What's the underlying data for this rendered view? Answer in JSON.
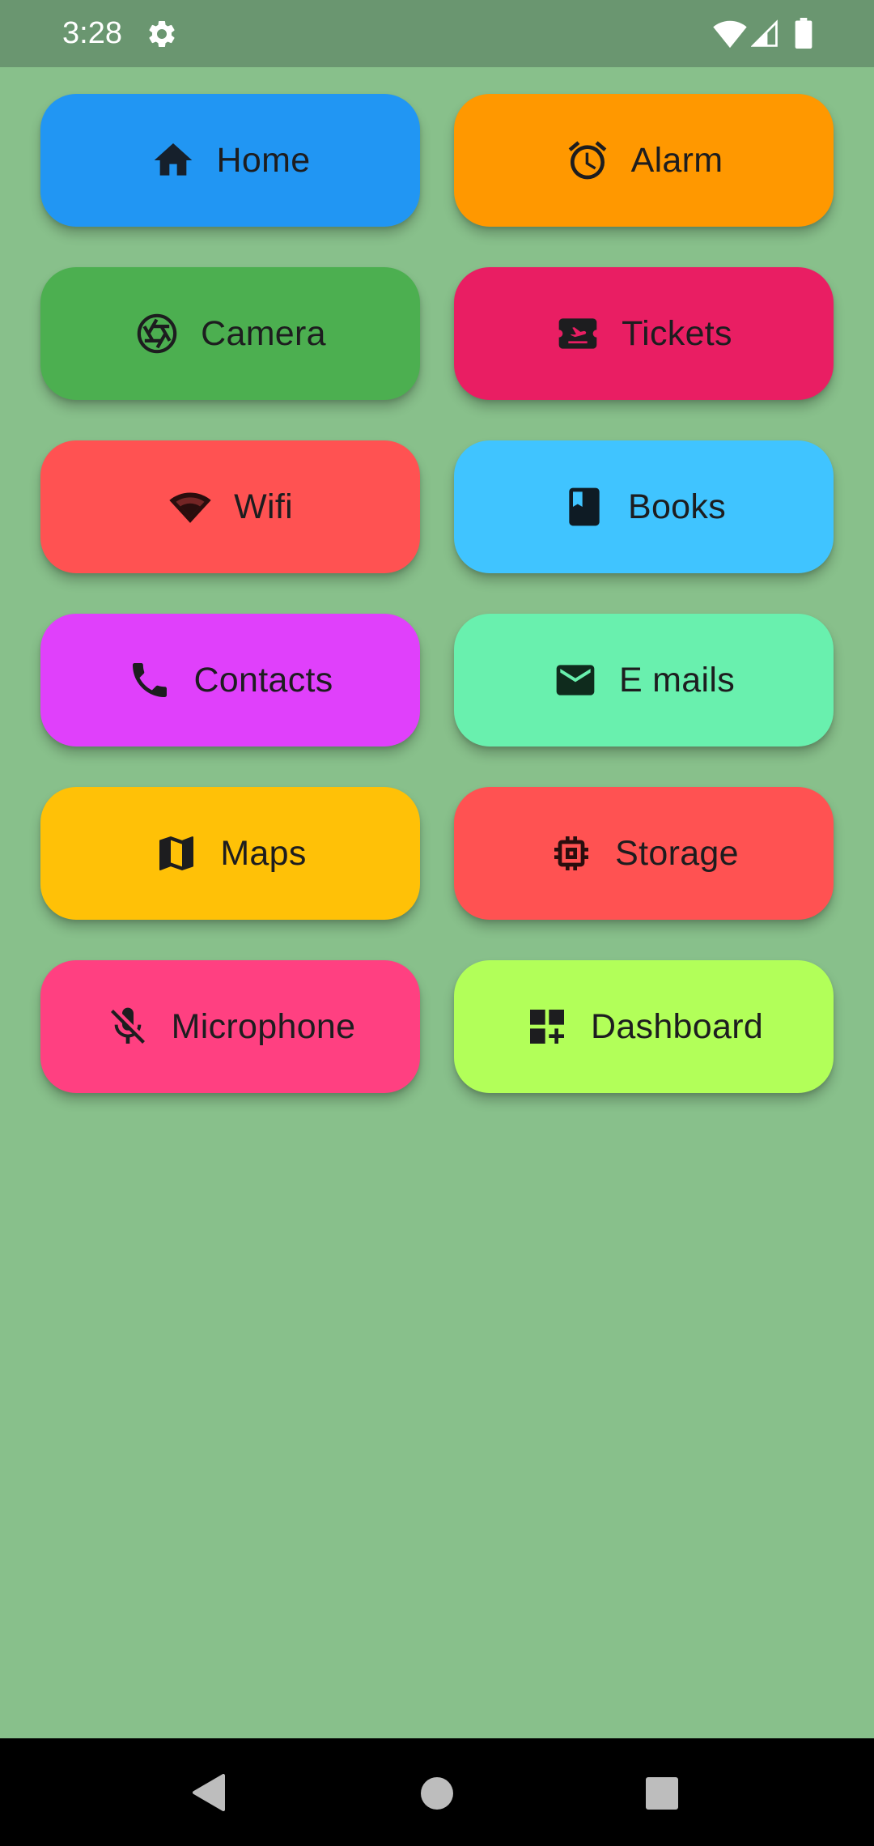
{
  "status_bar": {
    "time": "3:28",
    "icons": [
      "gear-icon",
      "wifi-icon",
      "signal-icon",
      "battery-icon"
    ],
    "background": "#6a9670"
  },
  "background_color": "#88c08b",
  "tiles": [
    {
      "label": "Home",
      "icon": "home-icon",
      "color": "#2196f3"
    },
    {
      "label": "Alarm",
      "icon": "alarm-icon",
      "color": "#ff9800"
    },
    {
      "label": "Camera",
      "icon": "camera-icon",
      "color": "#4caf50"
    },
    {
      "label": "Tickets",
      "icon": "ticket-icon",
      "color": "#e91e63"
    },
    {
      "label": "Wifi",
      "icon": "wifi-icon",
      "color": "#ff5252"
    },
    {
      "label": "Books",
      "icon": "book-icon",
      "color": "#40c4ff"
    },
    {
      "label": "Contacts",
      "icon": "phone-icon",
      "color": "#e040fb"
    },
    {
      "label": "E mails",
      "icon": "mail-icon",
      "color": "#69f0ae"
    },
    {
      "label": "Maps",
      "icon": "map-icon",
      "color": "#ffc107"
    },
    {
      "label": "Storage",
      "icon": "chip-icon",
      "color": "#ff5252"
    },
    {
      "label": "Microphone",
      "icon": "mic-off-icon",
      "color": "#ff4081"
    },
    {
      "label": "Dashboard",
      "icon": "dashboard-customize-icon",
      "color": "#b2ff59"
    }
  ],
  "nav_bar": {
    "buttons": [
      "back-icon",
      "home-circle-icon",
      "recents-icon"
    ]
  }
}
